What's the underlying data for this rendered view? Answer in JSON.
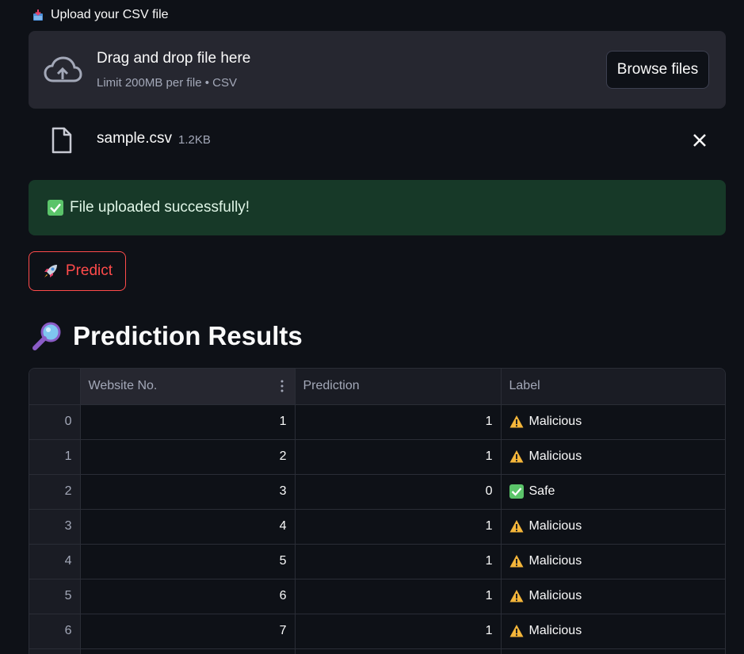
{
  "uploader": {
    "label": "Upload your CSV file",
    "drop_title": "Drag and drop file here",
    "drop_subtitle": "Limit 200MB per file • CSV",
    "browse_label": "Browse files"
  },
  "file": {
    "name": "sample.csv",
    "size": "1.2KB"
  },
  "alert": {
    "text": "File uploaded successfully!",
    "color": "#173928"
  },
  "predict_button": {
    "label": "Predict",
    "color": "#ff4b4b"
  },
  "results": {
    "title": "Prediction Results",
    "columns": [
      "",
      "Website No.",
      "Prediction",
      "Label"
    ],
    "rows": [
      {
        "index": "0",
        "website_no": "1",
        "prediction": "1",
        "label": "Malicious",
        "icon": "warning-icon"
      },
      {
        "index": "1",
        "website_no": "2",
        "prediction": "1",
        "label": "Malicious",
        "icon": "warning-icon"
      },
      {
        "index": "2",
        "website_no": "3",
        "prediction": "0",
        "label": "Safe",
        "icon": "check-icon"
      },
      {
        "index": "3",
        "website_no": "4",
        "prediction": "1",
        "label": "Malicious",
        "icon": "warning-icon"
      },
      {
        "index": "4",
        "website_no": "5",
        "prediction": "1",
        "label": "Malicious",
        "icon": "warning-icon"
      },
      {
        "index": "5",
        "website_no": "6",
        "prediction": "1",
        "label": "Malicious",
        "icon": "warning-icon"
      },
      {
        "index": "6",
        "website_no": "7",
        "prediction": "1",
        "label": "Malicious",
        "icon": "warning-icon"
      },
      {
        "index": "7",
        "website_no": "",
        "prediction": "",
        "label": "",
        "icon": ""
      }
    ]
  },
  "colors": {
    "background": "#0e1117",
    "dropzone": "#262730",
    "accent": "#ff4b4b",
    "success": "#173928"
  }
}
